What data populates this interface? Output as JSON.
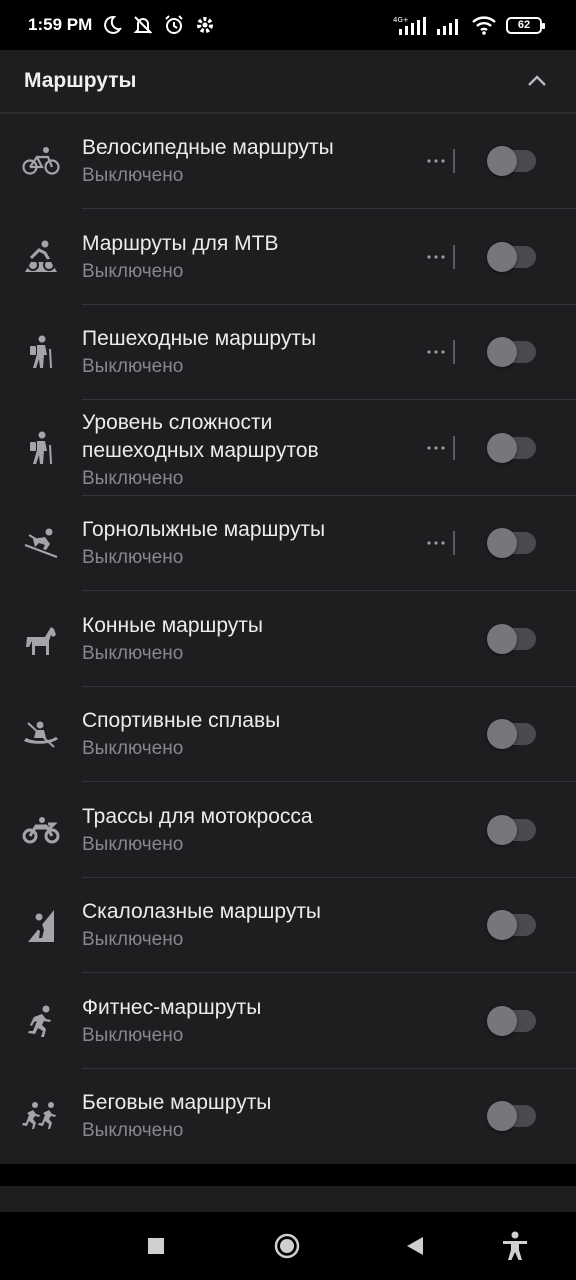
{
  "status_bar": {
    "time": "1:59 PM",
    "icons_left": [
      "moon-icon",
      "mute-icon",
      "alarm-icon",
      "settings-gear-icon"
    ],
    "network": "4G+",
    "battery": "62"
  },
  "section": {
    "title": "Маршруты",
    "collapse_icon": "chevron-up-icon"
  },
  "routes": [
    {
      "title": "Велосипедные маршруты",
      "subtitle": "Выключено",
      "icon": "bicycle-icon",
      "has_more": true,
      "enabled": false
    },
    {
      "title": "Маршруты для МТВ",
      "subtitle": "Выключено",
      "icon": "mountain-bike-icon",
      "has_more": true,
      "enabled": false
    },
    {
      "title": "Пешеходные маршруты",
      "subtitle": "Выключено",
      "icon": "hiker-icon",
      "has_more": true,
      "enabled": false
    },
    {
      "title": "Уровень сложности\nпешеходных маршрутов",
      "subtitle": "Выключено",
      "icon": "hiker-icon",
      "has_more": true,
      "enabled": false
    },
    {
      "title": "Горнолыжные маршруты",
      "subtitle": "Выключено",
      "icon": "skier-icon",
      "has_more": true,
      "enabled": false
    },
    {
      "title": "Конные маршруты",
      "subtitle": "Выключено",
      "icon": "horse-icon",
      "has_more": false,
      "enabled": false
    },
    {
      "title": "Спортивные сплавы",
      "subtitle": "Выключено",
      "icon": "kayak-icon",
      "has_more": false,
      "enabled": false
    },
    {
      "title": "Трассы для мотокросса",
      "subtitle": "Выключено",
      "icon": "motorcycle-icon",
      "has_more": false,
      "enabled": false
    },
    {
      "title": "Скалолазные маршруты",
      "subtitle": "Выключено",
      "icon": "climbing-icon",
      "has_more": false,
      "enabled": false
    },
    {
      "title": "Фитнес-маршруты",
      "subtitle": "Выключено",
      "icon": "runner-icon",
      "has_more": false,
      "enabled": false
    },
    {
      "title": "Беговые маршруты",
      "subtitle": "Выключено",
      "icon": "runners-icon",
      "has_more": false,
      "enabled": false
    }
  ],
  "navigation_bar": [
    "recents-square-icon",
    "home-circle-icon",
    "back-triangle-icon",
    "accessibility-icon"
  ]
}
